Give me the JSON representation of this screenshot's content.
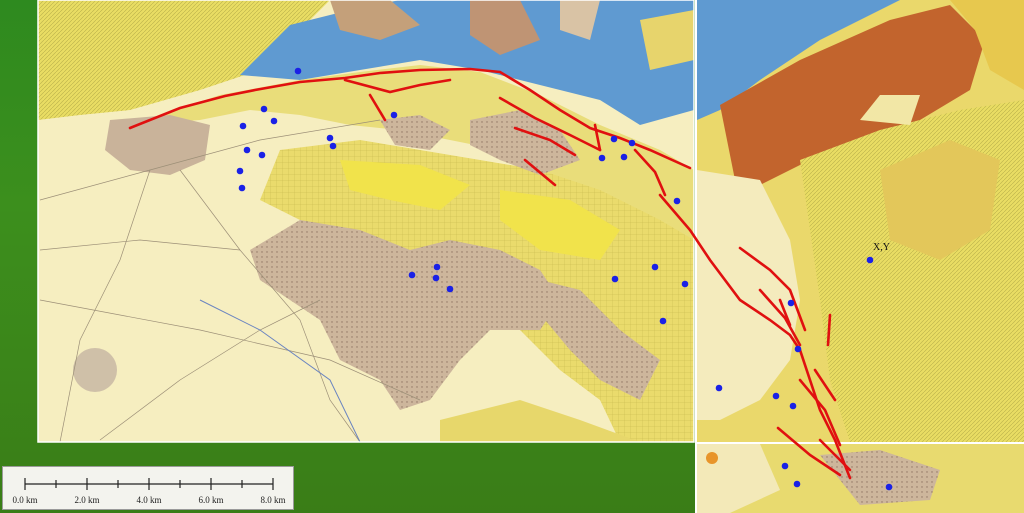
{
  "map": {
    "labels": {
      "xy": "X,Y"
    },
    "colors": {
      "background_green": "#3a8a1e",
      "plain": "#f5edb9",
      "yellow": "#eee06a",
      "bright_yellow": "#f2e54a",
      "alluvium": "#cbb79e",
      "blue": "#5f9ad1",
      "brown": "#c2642d",
      "fault": "#e01010",
      "point": "#1a21e6"
    }
  },
  "scale": {
    "ticks": [
      "0.0 km",
      "2.0 km",
      "4.0 km",
      "6.0 km",
      "8.0 km"
    ]
  }
}
